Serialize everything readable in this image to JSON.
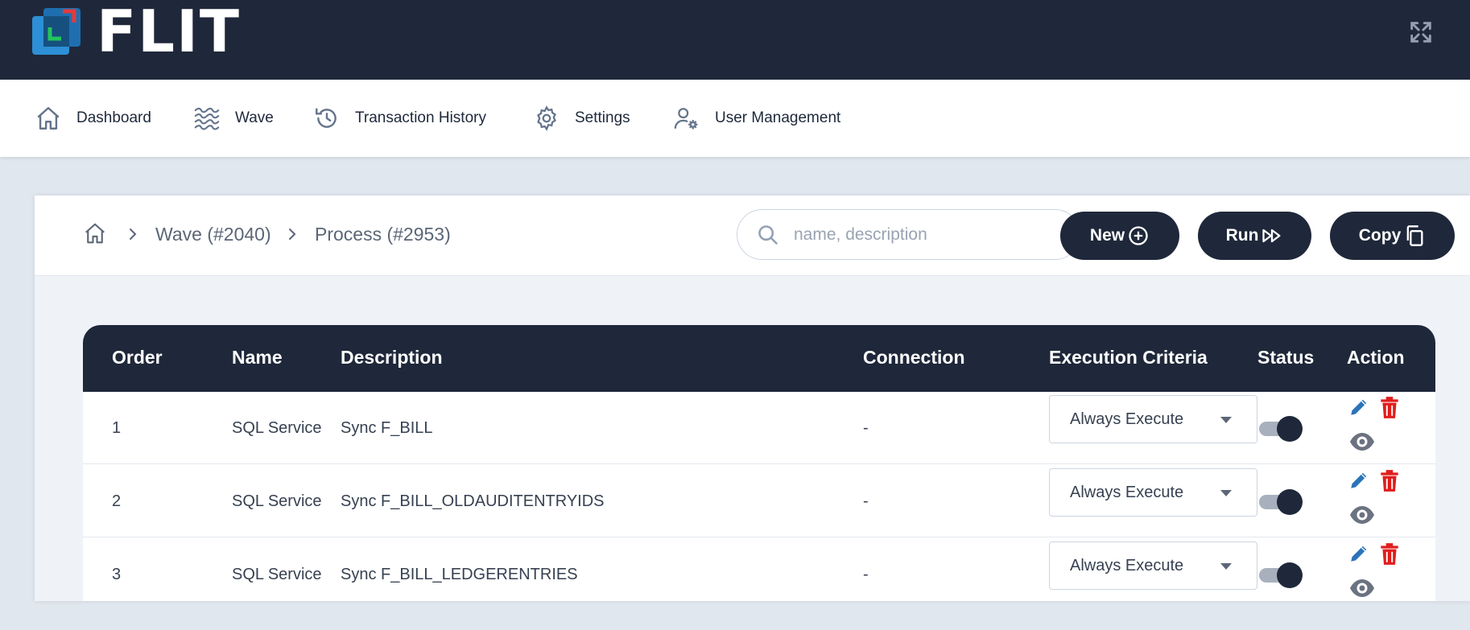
{
  "app": {
    "logo_text": "FLIT"
  },
  "nav": [
    {
      "label": "Dashboard"
    },
    {
      "label": "Wave"
    },
    {
      "label": "Transaction History"
    },
    {
      "label": "Settings"
    },
    {
      "label": "User Management"
    }
  ],
  "breadcrumb": {
    "wave": "Wave (#2040)",
    "process": "Process (#2953)"
  },
  "search": {
    "placeholder": "name, description",
    "value": ""
  },
  "toolbar": {
    "new_label": "New",
    "run_label": "Run",
    "copy_label": "Copy"
  },
  "table": {
    "headers": {
      "order": "Order",
      "name": "Name",
      "description": "Description",
      "connection": "Connection",
      "execution": "Execution Criteria",
      "status": "Status",
      "action": "Action"
    },
    "rows": [
      {
        "order": "1",
        "name": "SQL Service",
        "description": "Sync F_BILL",
        "connection": "-",
        "execution": "Always Execute",
        "status_on": true
      },
      {
        "order": "2",
        "name": "SQL Service",
        "description": "Sync F_BILL_OLDAUDITENTRYIDS",
        "connection": "-",
        "execution": "Always Execute",
        "status_on": true
      },
      {
        "order": "3",
        "name": "SQL Service",
        "description": "Sync F_BILL_LEDGERENTRIES",
        "connection": "-",
        "execution": "Always Execute",
        "status_on": true
      }
    ]
  },
  "icons": {
    "logo": "flit-logo-icon",
    "fullscreen": "fullscreen-icon",
    "home": "home-icon",
    "wave": "wave-icon",
    "history": "history-icon",
    "settings": "gear-icon",
    "users": "user-gear-icon",
    "search": "search-icon",
    "new": "plus-circle-icon",
    "run": "fast-forward-icon",
    "copy": "copy-icon",
    "edit": "pencil-icon",
    "delete": "trash-icon",
    "view": "eye-icon",
    "dropdown": "caret-down-icon"
  },
  "colors": {
    "primary": "#1f283a",
    "background": "#e1e7ef",
    "edit": "#2b74b8",
    "delete": "#e11d1d",
    "view": "#6b7280",
    "logo_blue": "#2d8fd5",
    "logo_red": "#e23b3b",
    "logo_green": "#22c55e"
  }
}
